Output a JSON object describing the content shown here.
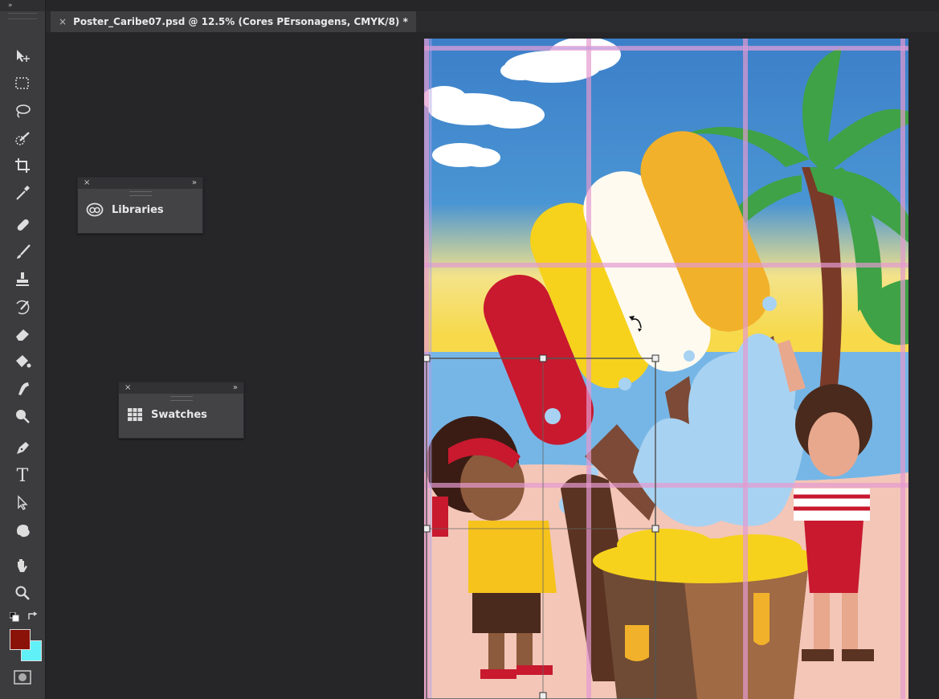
{
  "window": {
    "tab_title": "Poster_Caribe07.psd @ 12.5% (Cores PErsonagens, CMYK/8) *",
    "tab_close": "×",
    "toolbar_collapse": "»"
  },
  "toolbar": {
    "tools": [
      "move-tool",
      "marquee-tool",
      "lasso-tool",
      "quick-selection-tool",
      "crop-tool",
      "eyedropper-tool",
      "healing-brush-tool",
      "brush-tool",
      "clone-stamp-tool",
      "history-brush-tool",
      "eraser-tool",
      "paint-bucket-tool",
      "smudge-tool",
      "dodge-tool",
      "pen-tool",
      "type-tool",
      "path-selection-tool",
      "shape-tool",
      "hand-tool",
      "zoom-tool"
    ],
    "type_tool_glyph": "T",
    "foreground_color": "#8a1208",
    "background_color": "#5ff1f7"
  },
  "panels": {
    "libraries": {
      "label": "Libraries",
      "close": "×",
      "expand": "»"
    },
    "swatches": {
      "label": "Swatches",
      "close": "×",
      "expand": "»"
    }
  },
  "colors": {
    "sky": "#3f86cf",
    "palm_green": "#3fa246",
    "sand": "#f3c6b8",
    "red": "#c8192e",
    "yellow": "#f6d21d",
    "orange": "#f2b12a",
    "brown": "#7c4a36",
    "chest": "#6f4b35"
  }
}
